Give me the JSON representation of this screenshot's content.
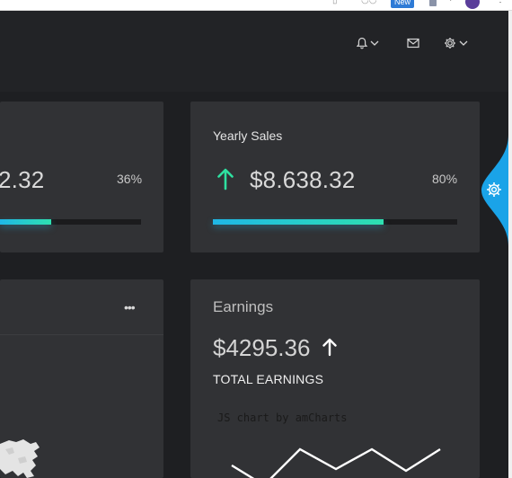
{
  "browser": {
    "new_badge": "New"
  },
  "header": {
    "icons": [
      "bell-icon",
      "mail-icon",
      "gear-icon"
    ]
  },
  "left_stat": {
    "value": "2.32",
    "percent": "36%",
    "progress": 0.36
  },
  "yearly_sales": {
    "title": "Yearly Sales",
    "value": "$8.638.32",
    "percent": "80%",
    "progress": 0.7,
    "trend_color": "#2ee0a0"
  },
  "left_panel": {
    "menu_label": "•••"
  },
  "earnings": {
    "title": "Earnings",
    "value": "$4295.36",
    "subtitle": "TOTAL EARNINGS",
    "chart_credit": "JS chart by amCharts"
  },
  "colors": {
    "accent": "#1fb7e6",
    "accent2": "#2ee0b0",
    "card": "#313235",
    "background": "#1e1f22",
    "settings_tab": "#1aa3e8"
  }
}
